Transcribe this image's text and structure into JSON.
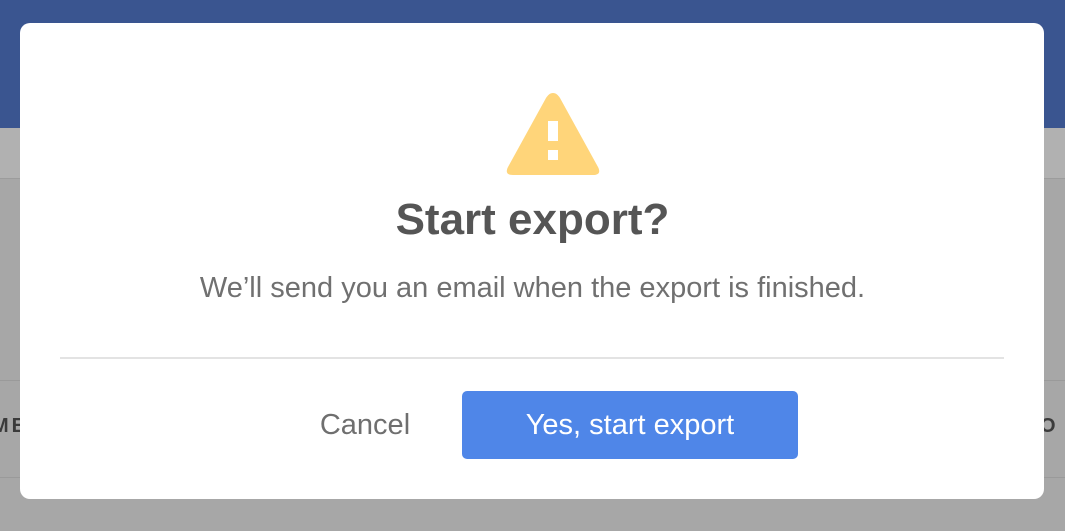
{
  "background": {
    "column_left_fragment": "ME",
    "column_right_fragment": "O"
  },
  "dialog": {
    "icon": "warning-triangle-icon",
    "title": "Start export?",
    "message": "We’ll send you an email when the export is finished.",
    "cancel_label": "Cancel",
    "confirm_label": "Yes, start export"
  },
  "colors": {
    "header": "#3a5590",
    "overlay": "#a7a7a7",
    "warning": "#ffd57a",
    "primary_button": "#4f86e8",
    "title_text": "#555555",
    "message_text": "#707070"
  }
}
